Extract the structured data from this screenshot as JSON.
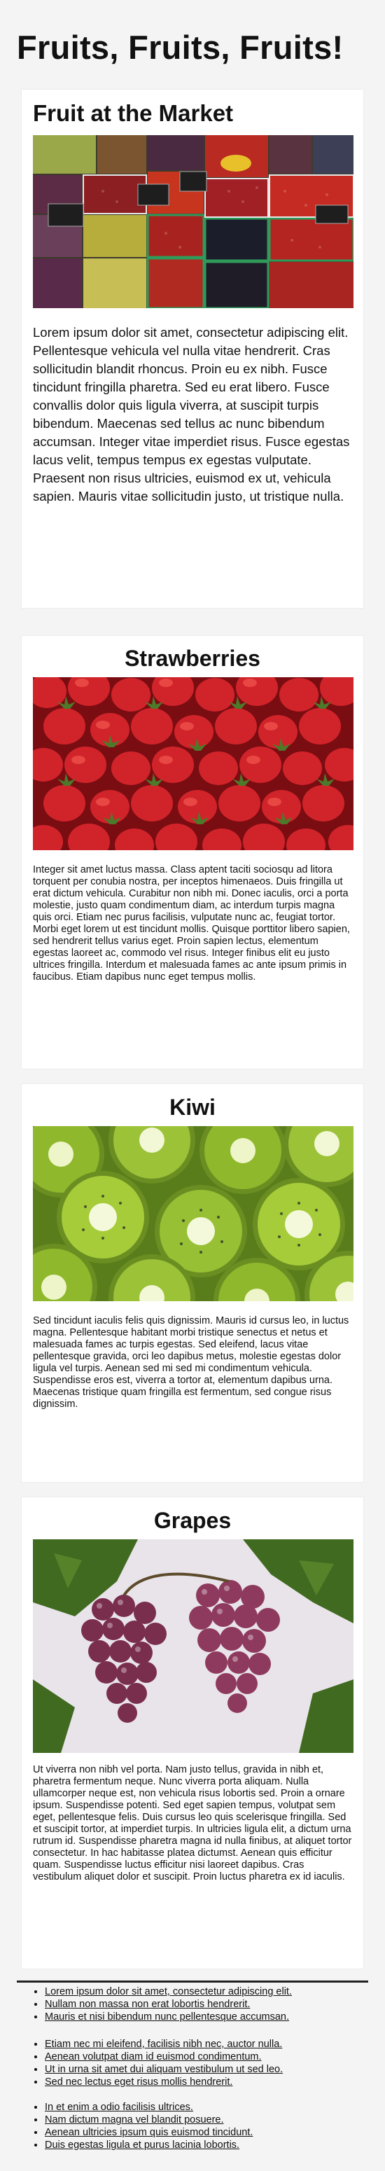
{
  "page": {
    "title": "Fruits, Fruits, Fruits!"
  },
  "intro": {
    "heading": "Fruit at the Market",
    "image_alt": "Market stall with crates of grapes, berries and cherries",
    "text": "Lorem ipsum dolor sit amet, consectetur adipiscing elit. Pellentesque vehicula vel nulla vitae hendrerit. Cras sollicitudin blandit rhoncus. Proin eu ex nibh. Fusce tincidunt fringilla pharetra. Sed eu erat libero. Fusce convallis dolor quis ligula viverra, at suscipit turpis bibendum. Maecenas sed tellus ac nunc bibendum accumsan. Integer vitae imperdiet risus. Fusce egestas lacus velit, tempus tempus ex egestas vulputate. Praesent non risus ultricies, euismod ex ut, vehicula sapien. Mauris vitae sollicitudin justo, ut tristique nulla."
  },
  "fruits": [
    {
      "heading": "Strawberries",
      "image_alt": "Pile of strawberries",
      "text": "Integer sit amet luctus massa. Class aptent taciti sociosqu ad litora torquent per conubia nostra, per inceptos himenaeos. Duis fringilla ut erat dictum vehicula. Curabitur non nibh mi. Donec iaculis, orci a porta molestie, justo quam condimentum diam, ac interdum turpis magna quis orci. Etiam nec purus facilisis, vulputate nunc ac, feugiat tortor. Morbi eget lorem ut est tincidunt mollis. Quisque porttitor libero sapien, sed hendrerit tellus varius eget. Proin sapien lectus, elementum egestas laoreet ac, commodo vel risus. Integer finibus elit eu justo ultrices fringilla. Interdum et malesuada fames ac ante ipsum primis in faucibus. Etiam dapibus nunc eget tempus mollis."
    },
    {
      "heading": "Kiwi",
      "image_alt": "Sliced kiwi fruit",
      "text": "Sed tincidunt iaculis felis quis dignissim. Mauris id cursus leo, in luctus magna. Pellentesque habitant morbi tristique senectus et netus et malesuada fames ac turpis egestas. Sed eleifend, lacus vitae pellentesque gravida, orci leo dapibus metus, molestie egestas dolor ligula vel turpis. Aenean sed mi sed mi condimentum vehicula. Suspendisse eros est, viverra a tortor at, elementum dapibus urna. Maecenas tristique quam fringilla est fermentum, sed congue risus dignissim."
    },
    {
      "heading": "Grapes",
      "image_alt": "Bunches of red grapes on the vine",
      "text": "Ut viverra non nibh vel porta. Nam justo tellus, gravida in nibh et, pharetra fermentum neque. Nunc viverra porta aliquam. Nulla ullamcorper neque est, non vehicula risus lobortis sed. Proin a ornare ipsum. Suspendisse potenti. Sed eget sapien tempus, volutpat sem eget, pellentesque felis. Duis cursus leo quis scelerisque fringilla. Sed et suscipit tortor, at imperdiet turpis. In ultricies ligula elit, a dictum urna rutrum id. Suspendisse pharetra magna id nulla finibus, at aliquet tortor consectetur. In hac habitasse platea dictumst. Aenean quis efficitur quam. Suspendisse luctus efficitur nisi laoreet dapibus. Cras vestibulum aliquet dolor et suscipit. Proin luctus pharetra ex id iaculis."
    }
  ],
  "footer": {
    "groups": [
      [
        "Lorem ipsum dolor sit amet, consectetur adipiscing elit.",
        "Nullam non massa non erat lobortis hendrerit.",
        "Mauris et nisi bibendum nunc pellentesque accumsan."
      ],
      [
        "Etiam nec mi eleifend, facilisis nibh nec, auctor nulla.",
        "Aenean volutpat diam id euismod condimentum.",
        "Ut in urna sit amet dui aliquam vestibulum ut sed leo.",
        "Sed nec lectus eget risus mollis hendrerit."
      ],
      [
        "In et enim a odio facilisis ultrices.",
        "Nam dictum magna vel blandit posuere.",
        "Aenean ultricies ipsum quis euismod tincidunt.",
        "Duis egestas ligula et purus lacinia lobortis."
      ]
    ]
  }
}
